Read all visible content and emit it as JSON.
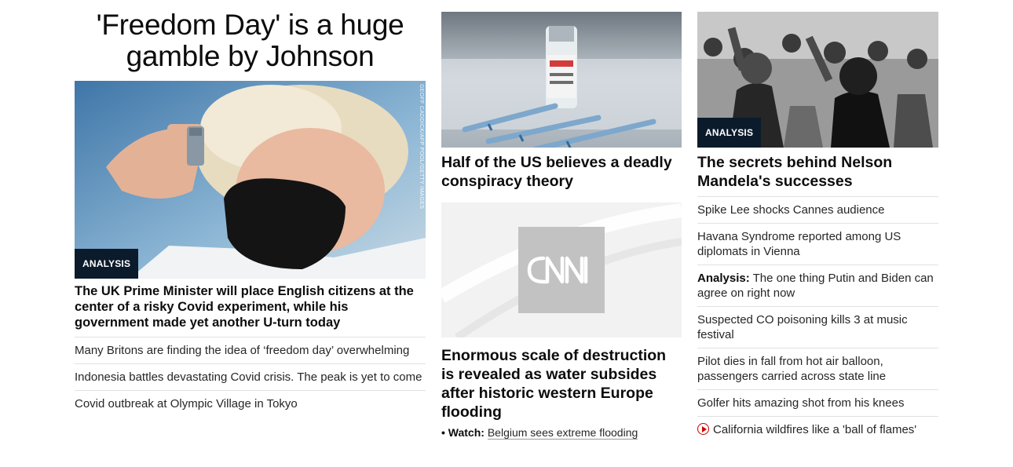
{
  "column1": {
    "headline": "'Freedom Day' is a huge gamble by Johnson",
    "hero_badge": "ANALYSIS",
    "photo_credit": "GEOFF CADDICK/AFP POOL/GETTY IMAGES",
    "lead_title": "The UK Prime Minister will place English citizens at the center of a risky Covid experiment, while his government made yet another U-turn today",
    "related": [
      "Many Britons are finding the idea of ‘freedom day’ overwhelming",
      "Indonesia battles devastating Covid crisis. The peak is yet to come",
      "Covid outbreak at Olympic Village in Tokyo"
    ]
  },
  "column2": {
    "story1_title": "Half of the US believes a deadly conspiracy theory",
    "cnn_logo_text": "CNN",
    "story2_title": "Enormous scale of destruction is revealed as water subsides after historic western Europe flooding",
    "watch_label": "• Watch:",
    "watch_text": "Belgium sees extreme flooding"
  },
  "column3": {
    "hero_badge": "ANALYSIS",
    "title": "The secrets behind Nelson Mandela's successes",
    "items": [
      {
        "prefix": "",
        "text": "Spike Lee shocks Cannes audience"
      },
      {
        "prefix": "",
        "text": "Havana Syndrome reported among US diplomats in Vienna"
      },
      {
        "prefix": "Analysis:",
        "text": " The one thing Putin and Biden can agree on right now"
      },
      {
        "prefix": "",
        "text": "Suspected CO poisoning kills 3 at music festival"
      },
      {
        "prefix": "",
        "text": "Pilot dies in fall from hot air balloon, passengers carried across state line"
      },
      {
        "prefix": "",
        "text": "Golfer hits amazing shot from his knees"
      },
      {
        "prefix": "",
        "text": "California wildfires like a 'ball of flames'",
        "icon": "play-video-icon"
      }
    ]
  },
  "colors": {
    "badge_bg": "#0c1b2b",
    "video_icon": "#cc0000",
    "divider": "#e1e1e1"
  }
}
